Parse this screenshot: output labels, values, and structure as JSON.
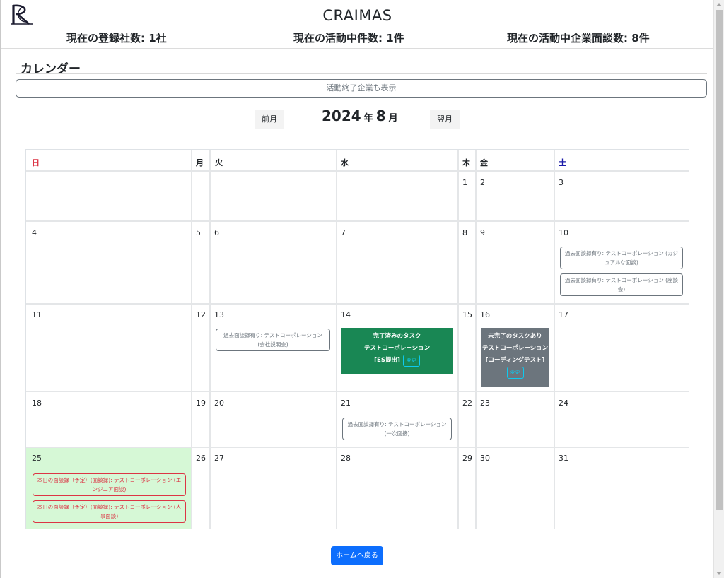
{
  "header": {
    "logo_text": "R",
    "title": "CRAIMAS",
    "stats": [
      "現在の登録社数: 1社",
      "現在の活動中件数: 1件",
      "現在の活動中企業面談数: 8件"
    ]
  },
  "calendar_section": {
    "title": "カレンダー",
    "toggle_label": "活動終了企業も表示",
    "prev_label": "前月",
    "next_label": "翌月",
    "year": "2024",
    "year_unit": "年",
    "month": "8",
    "month_unit": "月",
    "weekdays": [
      "日",
      "月",
      "火",
      "水",
      "木",
      "金",
      "土"
    ],
    "days": [
      "1",
      "2",
      "3",
      "4",
      "5",
      "6",
      "7",
      "8",
      "9",
      "10",
      "11",
      "12",
      "13",
      "14",
      "15",
      "16",
      "17",
      "18",
      "19",
      "20",
      "21",
      "22",
      "23",
      "24",
      "25",
      "26",
      "27",
      "28",
      "29",
      "30",
      "31"
    ],
    "events": {
      "e10a": "過去面談録有り: テストコーポレーション (カジュアルな面談)",
      "e10b": "過去面談録有り: テストコーポレーション (座談会)",
      "e13": "過去面談録有り: テストコーポレーション (会社説明会)",
      "e14_line1": "完了済みのタスク",
      "e14_line2": "テストコーポレーション",
      "e14_line3": "[ES提出]",
      "e14_button": "変更",
      "e16_line1": "未完了のタスクあり",
      "e16_line2": "テストコーポレーション",
      "e16_line3": "[コーディングテスト]",
      "e16_button": "変更",
      "e21": "過去面談録有り: テストコーポレーション (一次面接)",
      "e25a": "本日の面談録（予定）(面談録): テストコーポレーション (エンジニア面談)",
      "e25b": "本日の面談録（予定）(面談録): テストコーポレーション (人事面談)"
    },
    "colors": {
      "sunday": "#dc3545",
      "saturday": "#1a1aa8",
      "today_bg": "#d6f8d6",
      "completed_task": "#198754",
      "pending_task": "#6c757d",
      "primary": "#0d6efd"
    }
  },
  "footer": {
    "home_label": "ホームへ戻る"
  }
}
